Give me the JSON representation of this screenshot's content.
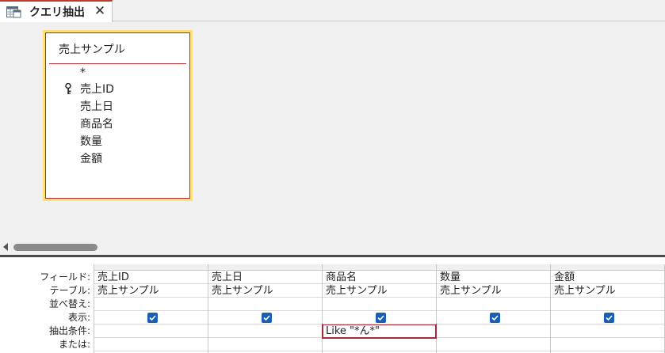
{
  "tab": {
    "icon": "query-datasheet-icon",
    "title": "クエリ抽出",
    "close_label": "✕"
  },
  "field_list": {
    "table_name": "売上サンプル",
    "fields": [
      {
        "name": "*",
        "primary_key": false
      },
      {
        "name": "売上ID",
        "primary_key": true
      },
      {
        "name": "売上日",
        "primary_key": false
      },
      {
        "name": "商品名",
        "primary_key": false
      },
      {
        "name": "数量",
        "primary_key": false
      },
      {
        "name": "金額",
        "primary_key": false
      }
    ]
  },
  "grid": {
    "row_labels": {
      "field": "フィールド:",
      "table": "テーブル:",
      "sort": "並べ替え:",
      "show": "表示:",
      "criteria": "抽出条件:",
      "or": "または:"
    },
    "columns": [
      {
        "field": "売上ID",
        "table": "売上サンプル",
        "sort": "",
        "show": true,
        "criteria": "",
        "or": ""
      },
      {
        "field": "売上日",
        "table": "売上サンプル",
        "sort": "",
        "show": true,
        "criteria": "",
        "or": ""
      },
      {
        "field": "商品名",
        "table": "売上サンプル",
        "sort": "",
        "show": true,
        "criteria": "Like \"*ん*\"",
        "or": ""
      },
      {
        "field": "数量",
        "table": "売上サンプル",
        "sort": "",
        "show": true,
        "criteria": "",
        "or": ""
      },
      {
        "field": "金額",
        "table": "売上サンプル",
        "sort": "",
        "show": true,
        "criteria": "",
        "or": ""
      }
    ]
  },
  "colors": {
    "tab_accent": "#c0392b",
    "field_list_highlight": "#ffe07a",
    "field_list_border": "#b52b2b",
    "checkbox": "#1a5fb4",
    "criteria_outline": "#a52a3a"
  }
}
